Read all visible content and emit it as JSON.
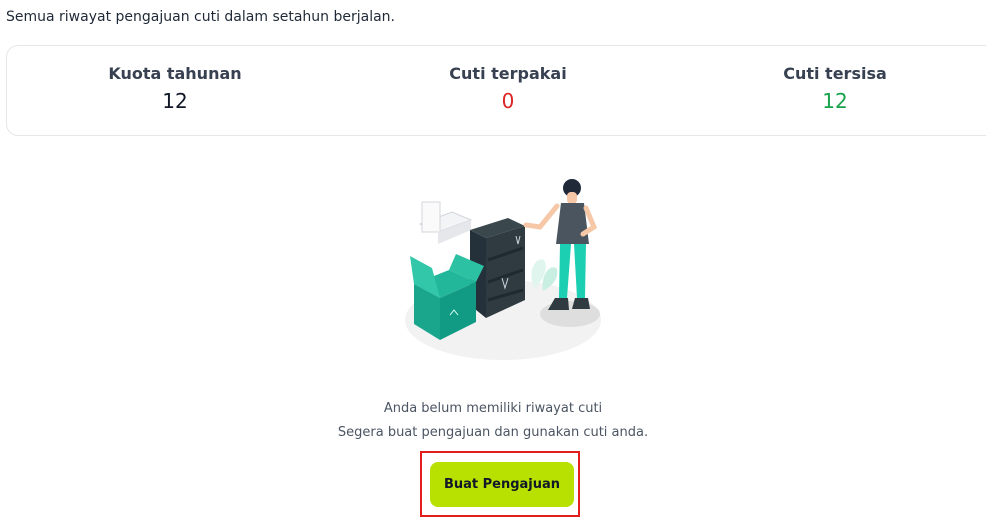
{
  "page": {
    "subtitle": "Semua riwayat pengajuan cuti dalam setahun berjalan."
  },
  "stats": {
    "quota_label": "Kuota tahunan",
    "quota_value": "12",
    "used_label": "Cuti terpakai",
    "used_value": "0",
    "remaining_label": "Cuti tersisa",
    "remaining_value": "12"
  },
  "colors": {
    "used_value": "#dc2626",
    "remaining_value": "#16a34a",
    "button_bg": "#b8e000",
    "highlight_border": "#e11d1d",
    "illustration_teal": "#1fb59a",
    "illustration_dark": "#2f3b41"
  },
  "empty_state": {
    "illustration": "empty-room-person-illustration",
    "line1": "Anda belum memiliki riwayat cuti",
    "line2": "Segera buat pengajuan dan gunakan cuti anda.",
    "button_label": "Buat Pengajuan"
  }
}
